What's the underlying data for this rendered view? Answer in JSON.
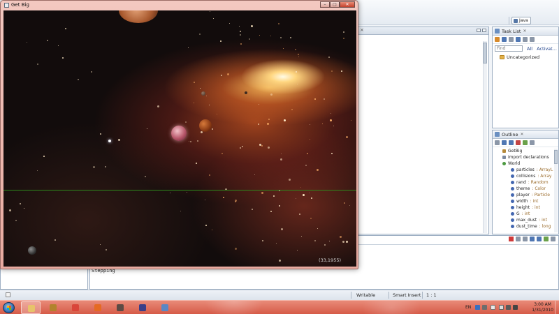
{
  "ide": {
    "perspective_label": "Java",
    "task_list": {
      "title": "Task List",
      "find_placeholder": "Find",
      "all_label": "All",
      "activate_label": "Activat...",
      "category": "Uncategorized"
    },
    "outline": {
      "title": "Outline",
      "items": [
        {
          "name": "GetBig",
          "type": "",
          "kind": "pkg"
        },
        {
          "name": "import declarations",
          "type": "",
          "kind": "imp"
        },
        {
          "name": "World",
          "type": "",
          "kind": "cls"
        },
        {
          "name": "particles",
          "type": ": ArrayL",
          "kind": "fld"
        },
        {
          "name": "collisions",
          "type": ": Array",
          "kind": "fld"
        },
        {
          "name": "rand",
          "type": ": Random",
          "kind": "fld"
        },
        {
          "name": "theme",
          "type": ": Color",
          "kind": "fld"
        },
        {
          "name": "player",
          "type": ": Particle",
          "kind": "fld"
        },
        {
          "name": "width",
          "type": ": int",
          "kind": "fld"
        },
        {
          "name": "height",
          "type": ": int",
          "kind": "fld"
        },
        {
          "name": "G",
          "type": ": int",
          "kind": "fld"
        },
        {
          "name": "max_dust",
          "type": ": int",
          "kind": "fld"
        },
        {
          "name": "dust_time",
          "type": ": long",
          "kind": "fld"
        }
      ]
    },
    "console": {
      "text": "Stepping"
    },
    "status_bar": {
      "writable": "Writable",
      "insert_mode": "Smart Insert",
      "position": "1 : 1"
    }
  },
  "game_window": {
    "title": "Get Big",
    "coords": "(33,1955)",
    "buttons": {
      "minimize": "–",
      "maximize": "□",
      "close": "✕"
    }
  },
  "taskbar": {
    "apps": [
      {
        "name": "explorer",
        "color": "#e7c36a"
      },
      {
        "name": "winamp",
        "color": "#b2832d"
      },
      {
        "name": "chrome",
        "color": "#d9463a"
      },
      {
        "name": "firefox",
        "color": "#e56a23"
      },
      {
        "name": "tool",
        "color": "#5c4a44"
      },
      {
        "name": "eclipse",
        "color": "#3b3f88"
      },
      {
        "name": "java",
        "color": "#5b87c4"
      }
    ],
    "language": "EN",
    "time": "3:00 AM",
    "date": "1/31/2010"
  }
}
